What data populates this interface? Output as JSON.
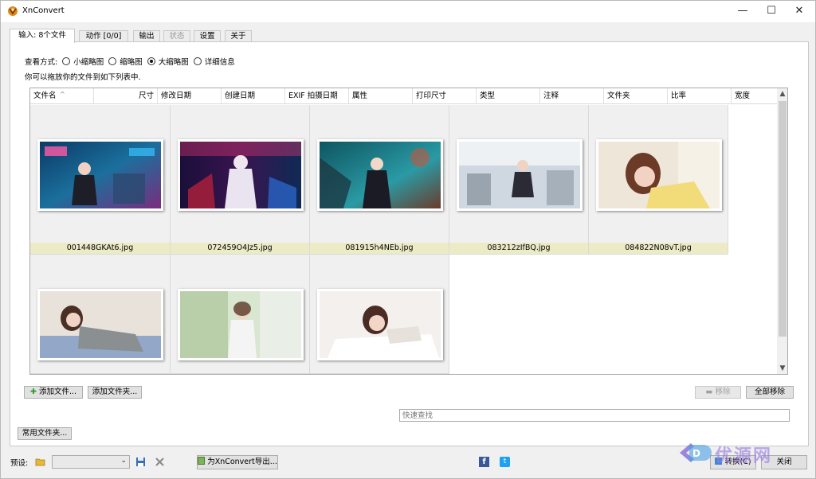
{
  "window": {
    "title": "XnConvert",
    "minimize": "—",
    "maximize": "☐",
    "close": "✕"
  },
  "tabs": [
    {
      "label": "输入: 8个文件",
      "active": true,
      "enabled": true
    },
    {
      "label": "动作 [0/0]",
      "active": false,
      "enabled": true
    },
    {
      "label": "输出",
      "active": false,
      "enabled": true
    },
    {
      "label": "状态",
      "active": false,
      "enabled": false
    },
    {
      "label": "设置",
      "active": false,
      "enabled": true
    },
    {
      "label": "关于",
      "active": false,
      "enabled": true
    }
  ],
  "view_mode": {
    "label": "查看方式:",
    "options": [
      "小缩略图",
      "缩略图",
      "大缩略图",
      "详细信息"
    ],
    "selected": "大缩略图"
  },
  "hint": "你可以拖放你的文件到如下列表中.",
  "columns": [
    "文件名",
    "尺寸",
    "修改日期",
    "创建日期",
    "EXIF 拍摄日期",
    "属性",
    "打印尺寸",
    "类型",
    "注释",
    "文件夹",
    "比率",
    "宽度"
  ],
  "files": [
    {
      "name": "001448GKAt6.jpg"
    },
    {
      "name": "072459O4Jz5.jpg"
    },
    {
      "name": "081915h4NEb.jpg"
    },
    {
      "name": "083212zIfBQ.jpg"
    },
    {
      "name": "084822N08vT.jpg"
    },
    {
      "name": ""
    },
    {
      "name": ""
    },
    {
      "name": ""
    }
  ],
  "buttons": {
    "add_files": "添加文件...",
    "add_folder": "添加文件夹...",
    "remove": "移除",
    "remove_all": "全部移除",
    "common_folders": "常用文件夹...",
    "export": "为XnConvert导出...",
    "convert": "转换(C)",
    "close": "关闭"
  },
  "search": {
    "placeholder": "快速查找"
  },
  "preset": {
    "label": "预设:",
    "value": ""
  },
  "watermark": {
    "text": "优源网"
  },
  "colors": {
    "caption_bg": "#ecebc6",
    "accent": "#0078d7"
  }
}
